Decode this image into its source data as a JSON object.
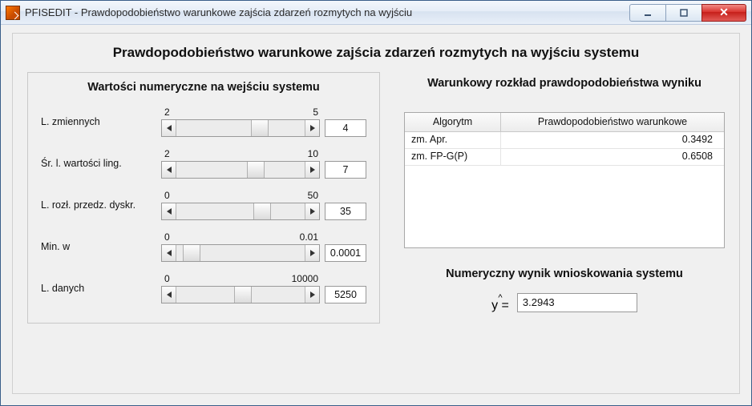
{
  "window": {
    "title": "PFISEDIT - Prawdopodobieństwo warunkowe zajścia zdarzeń rozmytych na wyjściu"
  },
  "main_heading": "Prawdopodobieństwo warunkowe zajścia zdarzeń rozmytych na wyjściu systemu",
  "left": {
    "group_title": "Wartości numeryczne na wejściu systemu",
    "rows": [
      {
        "label": "L. zmiennych",
        "min": "2",
        "max": "5",
        "value": "4",
        "thumb_pct": 58
      },
      {
        "label": "Śr. l. wartości ling.",
        "min": "2",
        "max": "10",
        "value": "7",
        "thumb_pct": 55
      },
      {
        "label": "L. rozł. przedz. dyskr.",
        "min": "0",
        "max": "50",
        "value": "35",
        "thumb_pct": 60
      },
      {
        "label": "Min. w",
        "min": "0",
        "max": "0.01",
        "value": "0.0001",
        "thumb_pct": 5
      },
      {
        "label": "L. danych",
        "min": "0",
        "max": "10000",
        "value": "5250",
        "thumb_pct": 45
      }
    ]
  },
  "right": {
    "dist_title": "Warunkowy rozkład prawdopodobieństwa wyniku",
    "table": {
      "head_algo": "Algorytm",
      "head_prob": "Prawdopodobieństwo warunkowe",
      "rows": [
        {
          "algo": "zm. Apr.",
          "prob": "0.3492"
        },
        {
          "algo": "zm. FP-G(P)",
          "prob": "0.6508"
        }
      ]
    },
    "result_title": "Numeryczny wynik wnioskowania systemu",
    "yhat_label_top": "^",
    "yhat_label": "y =",
    "result_value": "3.2943"
  }
}
